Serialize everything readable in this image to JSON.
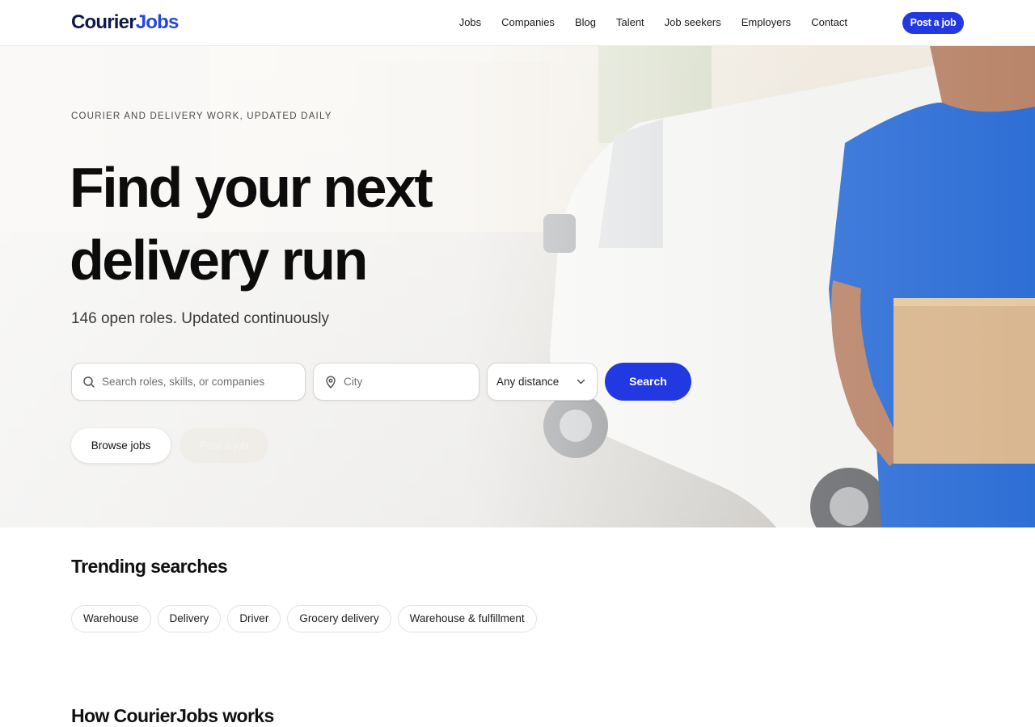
{
  "brand": {
    "name_part1": "Courier",
    "name_part2": "Jobs",
    "accent": "#2238e0",
    "dark": "#0f1a4a"
  },
  "nav": {
    "links": [
      "Jobs",
      "Companies",
      "Blog",
      "Talent",
      "Job seekers",
      "Employers",
      "Contact"
    ],
    "cta": "Post a job"
  },
  "hero": {
    "kicker": "COURIER AND DELIVERY WORK, UPDATED DAILY",
    "headline_line1": "Find your next",
    "headline_line2": "delivery run",
    "subhead": "146 open roles. Updated continuously",
    "search": {
      "query_placeholder": "Search roles, skills, or companies",
      "city_placeholder": "City",
      "distance_value": "Any distance",
      "button": "Search"
    },
    "browse_button": "Browse jobs",
    "post_button": "Post a job"
  },
  "trending": {
    "title": "Trending searches",
    "chips": [
      "Warehouse",
      "Delivery",
      "Driver",
      "Grocery delivery",
      "Warehouse & fulfillment"
    ]
  },
  "how": {
    "title": "How CourierJobs works"
  },
  "icons": {
    "query": "search-icon",
    "city": "map-pin-icon",
    "distance": "chevron-down-icon"
  }
}
